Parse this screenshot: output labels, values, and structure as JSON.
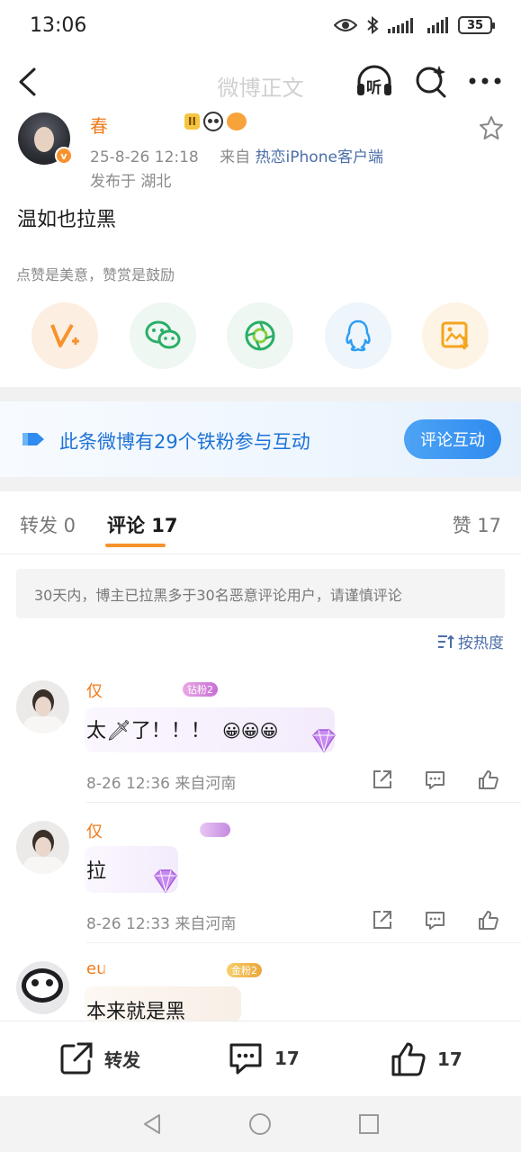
{
  "status_bar": {
    "time": "13:06",
    "battery": "35"
  },
  "nav": {
    "title": "微博正文",
    "listen_label": "听"
  },
  "post": {
    "author_name_visible": "春",
    "level_badge": "II",
    "time": "25-8-26 12:18",
    "source_prefix": "来自",
    "source_client": "热恋iPhone客户端",
    "location": "发布于 湖北",
    "text": "温如也拉黑",
    "tip": "点赞是美意，赞赏是鼓励",
    "verified_mark": "v"
  },
  "share_buttons": [
    {
      "name": "reward",
      "color": "#fdeee2"
    },
    {
      "name": "wechat",
      "color": "#eef7f1"
    },
    {
      "name": "moments",
      "color": "#eef7f1"
    },
    {
      "name": "qq",
      "color": "#eef5fb"
    },
    {
      "name": "save-image",
      "color": "#fdf4e6"
    }
  ],
  "fans_banner": {
    "text": "此条微博有29个铁粉参与互动",
    "button": "评论互动"
  },
  "tabs": {
    "repost": "转发 0",
    "comments": "评论 17",
    "likes": "赞 17"
  },
  "notice": "30天内，博主已拉黑多于30名恶意评论用户，请谨慎评论",
  "sort_label": "按热度",
  "comments": [
    {
      "name_visible": "仅",
      "badge": "钻粉2",
      "text": "太🗡了！！！",
      "emojis": "😀😀😀",
      "meta": "8-26 12:36 来自河南"
    },
    {
      "name_visible": "仅",
      "badge": "",
      "text": "拉",
      "emojis": "",
      "meta": "8-26 12:33 来自河南"
    },
    {
      "name_visible": "eu",
      "badge": "金粉2",
      "text": "本来就是黑",
      "emojis": "",
      "meta": ""
    }
  ],
  "bottom_bar": {
    "repost_label": "转发",
    "comment_count": "17",
    "like_count": "17"
  },
  "colors": {
    "accent": "#f7922c",
    "link": "#4b6ea8",
    "fans_blue": "#1e73d6"
  }
}
